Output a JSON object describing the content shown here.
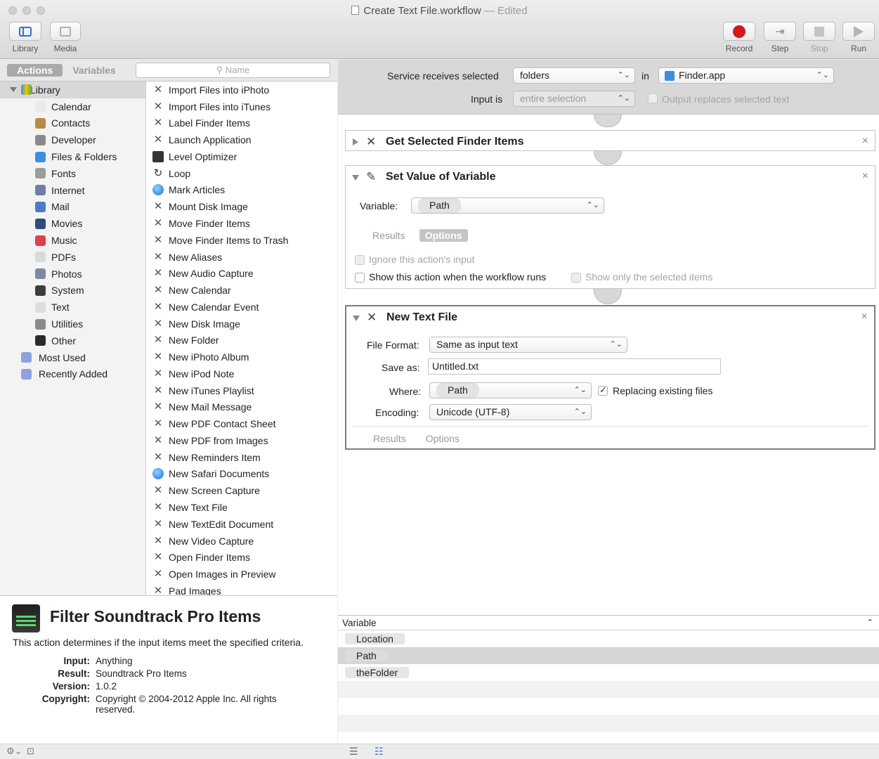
{
  "window": {
    "title": "Create Text File.workflow",
    "edited_label": "Edited"
  },
  "toolbar": {
    "library_label": "Library",
    "media_label": "Media",
    "record_label": "Record",
    "step_label": "Step",
    "stop_label": "Stop",
    "run_label": "Run"
  },
  "library": {
    "tabs": [
      "Actions",
      "Variables"
    ],
    "search_placeholder": "Name",
    "root_label": "Library",
    "categories": [
      {
        "label": "Calendar",
        "icon": "calendar-icon",
        "color": "#e9e9e9"
      },
      {
        "label": "Contacts",
        "icon": "contacts-icon",
        "color": "#b88a4a"
      },
      {
        "label": "Developer",
        "icon": "developer-icon",
        "color": "#8a8a8a"
      },
      {
        "label": "Files & Folders",
        "icon": "finder-icon",
        "color": "#3b8fe0"
      },
      {
        "label": "Fonts",
        "icon": "fonts-icon",
        "color": "#9c9c9c"
      },
      {
        "label": "Internet",
        "icon": "internet-icon",
        "color": "#6d7fa8"
      },
      {
        "label": "Mail",
        "icon": "mail-icon",
        "color": "#4f7bc4"
      },
      {
        "label": "Movies",
        "icon": "movies-icon",
        "color": "#2d4d7a"
      },
      {
        "label": "Music",
        "icon": "music-icon",
        "color": "#e0404a"
      },
      {
        "label": "PDFs",
        "icon": "pdf-icon",
        "color": "#d9d9d9"
      },
      {
        "label": "Photos",
        "icon": "photos-icon",
        "color": "#7b8aa0"
      },
      {
        "label": "System",
        "icon": "system-icon",
        "color": "#3d3d3d"
      },
      {
        "label": "Text",
        "icon": "text-icon",
        "color": "#dedede"
      },
      {
        "label": "Utilities",
        "icon": "utilities-icon",
        "color": "#8a8a8a"
      },
      {
        "label": "Other",
        "icon": "other-icon",
        "color": "#2a2a2a"
      }
    ],
    "smart_groups": [
      "Most Used",
      "Recently Added"
    ],
    "actions": [
      {
        "label": "Import Files into iPhoto",
        "icon": "automator-icon"
      },
      {
        "label": "Import Files into iTunes",
        "icon": "automator-icon"
      },
      {
        "label": "Label Finder Items",
        "icon": "automator-icon"
      },
      {
        "label": "Launch Application",
        "icon": "automator-icon"
      },
      {
        "label": "Level Optimizer",
        "icon": "film-icon"
      },
      {
        "label": "Loop",
        "icon": "loop-icon"
      },
      {
        "label": "Mark Articles",
        "icon": "safari-icon"
      },
      {
        "label": "Mount Disk Image",
        "icon": "automator-icon"
      },
      {
        "label": "Move Finder Items",
        "icon": "automator-icon"
      },
      {
        "label": "Move Finder Items to Trash",
        "icon": "automator-icon"
      },
      {
        "label": "New Aliases",
        "icon": "automator-icon"
      },
      {
        "label": "New Audio Capture",
        "icon": "automator-icon"
      },
      {
        "label": "New Calendar",
        "icon": "automator-icon"
      },
      {
        "label": "New Calendar Event",
        "icon": "automator-icon"
      },
      {
        "label": "New Disk Image",
        "icon": "automator-icon"
      },
      {
        "label": "New Folder",
        "icon": "automator-icon"
      },
      {
        "label": "New iPhoto Album",
        "icon": "automator-icon"
      },
      {
        "label": "New iPod Note",
        "icon": "automator-icon"
      },
      {
        "label": "New iTunes Playlist",
        "icon": "automator-icon"
      },
      {
        "label": "New Mail Message",
        "icon": "automator-icon"
      },
      {
        "label": "New PDF Contact Sheet",
        "icon": "automator-icon"
      },
      {
        "label": "New PDF from Images",
        "icon": "automator-icon"
      },
      {
        "label": "New Reminders Item",
        "icon": "automator-icon"
      },
      {
        "label": "New Safari Documents",
        "icon": "safari-icon"
      },
      {
        "label": "New Screen Capture",
        "icon": "automator-icon"
      },
      {
        "label": "New Text File",
        "icon": "automator-icon"
      },
      {
        "label": "New TextEdit Document",
        "icon": "automator-icon"
      },
      {
        "label": "New Video Capture",
        "icon": "automator-icon"
      },
      {
        "label": "Open Finder Items",
        "icon": "automator-icon"
      },
      {
        "label": "Open Images in Preview",
        "icon": "automator-icon"
      },
      {
        "label": "Pad Images",
        "icon": "automator-icon"
      }
    ]
  },
  "description": {
    "title": "Filter Soundtrack Pro Items",
    "text": "This action determines if the input items meet the specified criteria.",
    "input_key": "Input:",
    "input_value": "Anything",
    "result_key": "Result:",
    "result_value": "Soundtrack Pro Items",
    "version_key": "Version:",
    "version_value": "1.0.2",
    "copyright_key": "Copyright:",
    "copyright_value": "Copyright © 2004-2012 Apple Inc.  All rights reserved."
  },
  "service": {
    "receives_label": "Service receives selected",
    "receives_value": "folders",
    "in_label": "in",
    "app_value": "Finder.app",
    "input_is_label": "Input is",
    "input_is_value": "entire selection",
    "output_replaces_label": "Output replaces selected text"
  },
  "workflow": {
    "action1": {
      "title": "Get Selected Finder Items"
    },
    "action2": {
      "title": "Set Value of Variable",
      "variable_label": "Variable:",
      "variable_value": "Path",
      "tab_results": "Results",
      "tab_options": "Options",
      "ignore_input_label": "Ignore this action's input",
      "show_action_label": "Show this action when the workflow runs",
      "show_selected_label": "Show only the selected items"
    },
    "action3": {
      "title": "New Text File",
      "file_format_label": "File Format:",
      "file_format_value": "Same as input text",
      "save_as_label": "Save as:",
      "save_as_value": "Untitled.txt",
      "where_label": "Where:",
      "where_value": "Path",
      "replacing_label": "Replacing existing files",
      "encoding_label": "Encoding:",
      "encoding_value": "Unicode (UTF-8)",
      "tab_results": "Results",
      "tab_options": "Options"
    }
  },
  "variables_panel": {
    "header": "Variable",
    "items": [
      "Location",
      "Path",
      "theFolder"
    ]
  },
  "colors": {
    "record": "#d11a1a",
    "accent": "#2a73d8"
  }
}
